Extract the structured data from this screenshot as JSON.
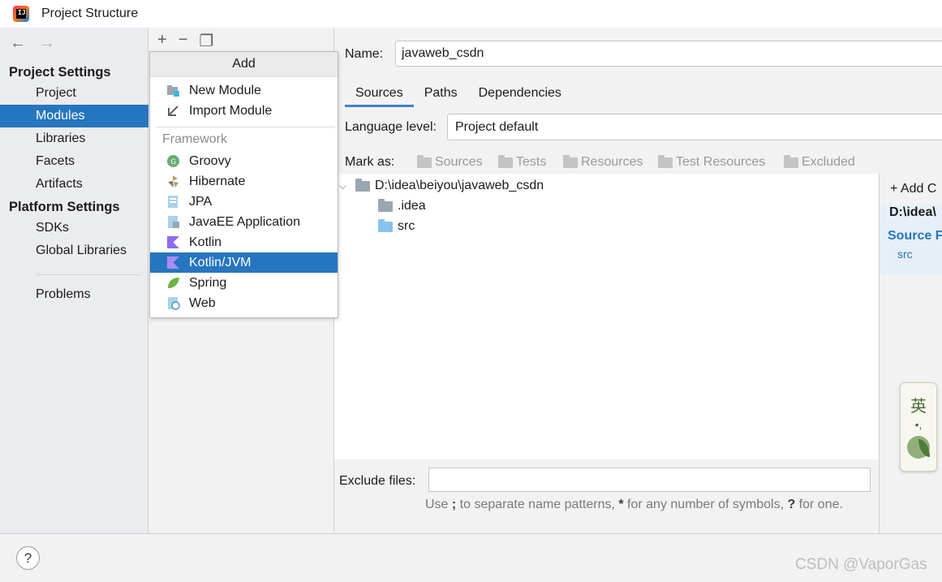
{
  "window": {
    "title": "Project Structure"
  },
  "nav": {
    "project_settings_header": "Project Settings",
    "project_items": [
      "Project",
      "Modules",
      "Libraries",
      "Facets",
      "Artifacts"
    ],
    "selected": "Modules",
    "platform_settings_header": "Platform Settings",
    "platform_items": [
      "SDKs",
      "Global Libraries"
    ],
    "problems": "Problems"
  },
  "popup": {
    "title": "Add",
    "items": [
      "New Module",
      "Import Module"
    ],
    "framework_header": "Framework",
    "frameworks": [
      "Groovy",
      "Hibernate",
      "JPA",
      "JavaEE Application",
      "Kotlin",
      "Kotlin/JVM",
      "Spring",
      "Web"
    ],
    "selected": "Kotlin/JVM"
  },
  "module": {
    "name_label": "Name:",
    "name_value": "javaweb_csdn",
    "tabs": [
      "Sources",
      "Paths",
      "Dependencies"
    ],
    "active_tab": "Sources",
    "language_level_label": "Language level:",
    "language_level_value": "Project default",
    "mark_as_label": "Mark as:",
    "mark_as_buttons": [
      "Sources",
      "Tests",
      "Resources",
      "Test Resources",
      "Excluded"
    ],
    "tree": {
      "root": "D:\\idea\\beiyou\\javaweb_csdn",
      "children": [
        ".idea",
        "src"
      ]
    },
    "content_root": {
      "add_button": "Add C",
      "path": "D:\\idea\\",
      "source_label": "Source F",
      "src": "src"
    },
    "exclude_files_label": "Exclude files:",
    "exclude_files_value": "",
    "exclude_hint": {
      "p1": "Use ",
      "k1": ";",
      "p2": " to separate name patterns, ",
      "k2": "*",
      "p3": " for any number of symbols, ",
      "k3": "?",
      "p4": " for one."
    }
  },
  "ime": {
    "char": "英",
    "dots": "•,"
  },
  "help_label": "?",
  "watermark": "CSDN @VaporGas",
  "colors": {
    "accent": "#2675bf",
    "folder_grey": "#9aa7b0",
    "folder_blue": "#87c3ec"
  }
}
